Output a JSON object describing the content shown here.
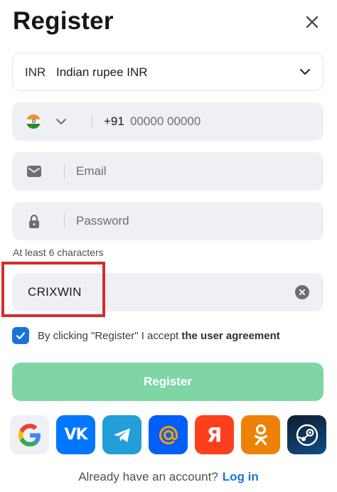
{
  "header": {
    "title": "Register"
  },
  "currency": {
    "code": "INR",
    "name": "Indian rupee INR"
  },
  "phone": {
    "prefix": "+91",
    "mask": "00000 00000"
  },
  "email": {
    "placeholder": "Email"
  },
  "password": {
    "placeholder": "Password",
    "hint": "At least 6 characters"
  },
  "promo": {
    "value": "CRIXWIN"
  },
  "agreement": {
    "checked": true,
    "text": "By clicking \"Register\" I accept ",
    "link": "the user agreement"
  },
  "register_button": {
    "label": "Register"
  },
  "socials": [
    {
      "name": "google-icon",
      "color": "#eef0f4"
    },
    {
      "name": "vk-icon",
      "color": "#0077ff",
      "glyph": "VK"
    },
    {
      "name": "telegram-icon",
      "color": "#229ed9"
    },
    {
      "name": "mailru-icon",
      "color": "#005ff9"
    },
    {
      "name": "yandex-icon",
      "color": "#fc3f1d",
      "glyph": "Я"
    },
    {
      "name": "odnoklassniki-icon",
      "color": "#ee8208"
    },
    {
      "name": "steam-icon",
      "color": "#0d4c85"
    }
  ],
  "footer": {
    "prompt": "Already have an account?",
    "login_label": "Log in"
  },
  "colors": {
    "accent": "#1a73d9",
    "register_button": "#7fd6a4",
    "highlight_box": "#d42c2c"
  }
}
